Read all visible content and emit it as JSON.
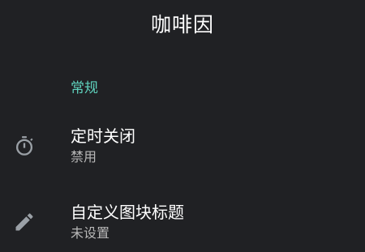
{
  "app": {
    "title": "咖啡因"
  },
  "section": {
    "header": "常规",
    "accent_color": "#5fd2bd"
  },
  "preferences": [
    {
      "icon": "timer-icon",
      "title": "定时关闭",
      "summary": "禁用"
    },
    {
      "icon": "pencil-icon",
      "title": "自定义图块标题",
      "summary": "未设置"
    }
  ]
}
